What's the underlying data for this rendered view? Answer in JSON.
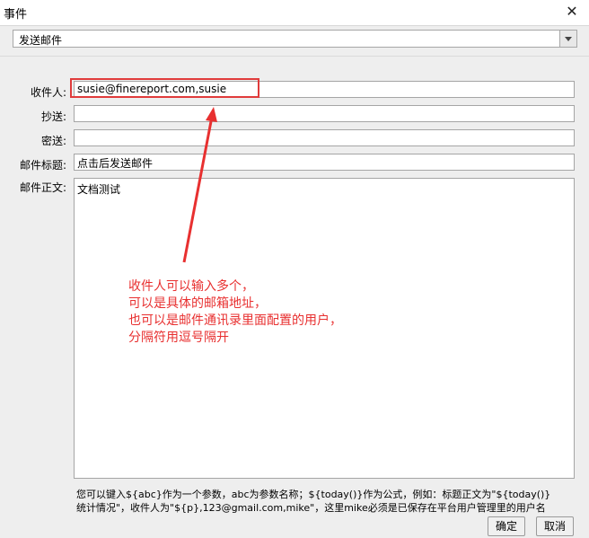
{
  "window": {
    "title": "事件"
  },
  "event_type": {
    "selected": "发送邮件"
  },
  "form": {
    "recipient_label": "收件人:",
    "recipient_value": "susie@finereport.com,susie",
    "cc_label": "抄送:",
    "cc_value": "",
    "bcc_label": "密送:",
    "bcc_value": "",
    "subject_label": "邮件标题:",
    "subject_value": "点击后发送邮件",
    "body_label": "邮件正文:",
    "body_value": "文档测试"
  },
  "annotation": {
    "lines": [
      "收件人可以输入多个，",
      "可以是具体的邮箱地址，",
      "也可以是邮件通讯录里面配置的用户，",
      "分隔符用逗号隔开"
    ],
    "color": "#e83030"
  },
  "hint": {
    "line1": "您可以键入${abc}作为一个参数，abc为参数名称；${today()}作为公式，例如：标题正文为\"${today()}",
    "line2": "统计情况\"，收件人为\"${p},123@gmail.com,mike\"，这里mike必须是已保存在平台用户管理里的用户名"
  },
  "buttons": {
    "ok": "确定",
    "cancel": "取消"
  }
}
